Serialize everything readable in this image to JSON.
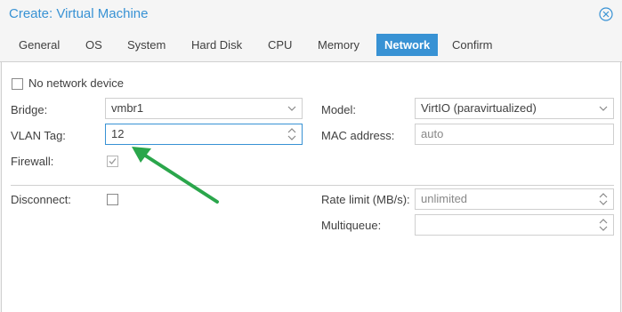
{
  "dialog": {
    "title": "Create: Virtual Machine"
  },
  "tabs": [
    "General",
    "OS",
    "System",
    "Hard Disk",
    "CPU",
    "Memory",
    "Network",
    "Confirm"
  ],
  "active_tab": "Network",
  "form": {
    "no_network_label": "No network device",
    "bridge_label": "Bridge:",
    "bridge_value": "vmbr1",
    "vlan_label": "VLAN Tag:",
    "vlan_value": "12",
    "firewall_label": "Firewall:",
    "model_label": "Model:",
    "model_value": "VirtIO (paravirtualized)",
    "mac_label": "MAC address:",
    "mac_placeholder": "auto",
    "disconnect_label": "Disconnect:",
    "rate_label": "Rate limit (MB/s):",
    "rate_placeholder": "unlimited",
    "multiqueue_label": "Multiqueue:"
  },
  "colors": {
    "accent": "#3892d4",
    "annotation_arrow": "#2aa64b"
  }
}
